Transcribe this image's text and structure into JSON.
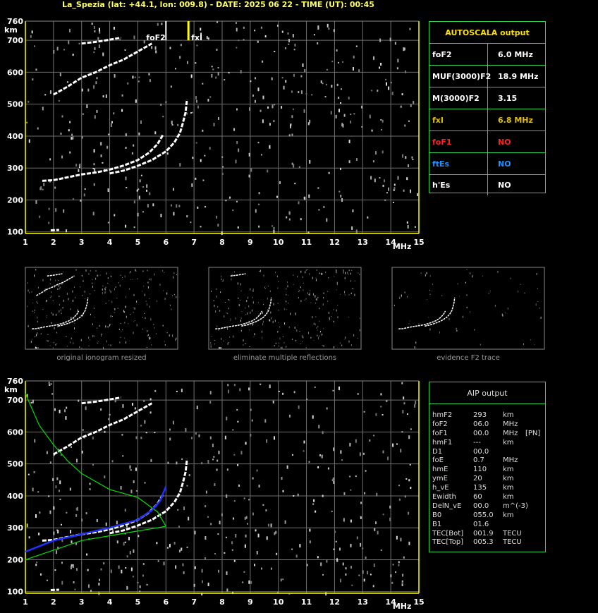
{
  "header": {
    "title": "La_Spezia (lat: +44.1, lon: 009.8) - DATE: 2025 06 22 - TIME (UT): 00:45"
  },
  "colors": {
    "frame": "#ffff00",
    "grid": "#707070",
    "table_border": "#2fcf4f",
    "profile_green": "#00e000",
    "profile_blue": "#2030ff",
    "foF1_label": "#ff2020",
    "ftEs_label": "#2090ff",
    "fxI_value": "#e0c000"
  },
  "chart_data": [
    {
      "type": "scatter",
      "name": "main-ionogram",
      "xlabel": "MHz",
      "ylabel": "km",
      "xlim": [
        1,
        15
      ],
      "ylim": [
        95,
        760
      ],
      "x_ticks": [
        "1",
        "2",
        "3",
        "4",
        "5",
        "6",
        "7",
        "8",
        "9",
        "10",
        "11",
        "12",
        "13",
        "14",
        "15"
      ],
      "y_ticks": [
        "100",
        "200",
        "300",
        "400",
        "500",
        "600",
        "700",
        "760"
      ],
      "markers": [
        {
          "label": "foF2",
          "x": 6.0
        },
        {
          "label": "fxI",
          "x": 6.8
        }
      ],
      "traces": [
        {
          "name": "o-trace",
          "x": [
            1.6,
            2.0,
            3.0,
            3.5,
            4.0,
            4.5,
            5.0,
            5.4,
            5.7,
            5.9
          ],
          "y": [
            260,
            262,
            280,
            286,
            295,
            308,
            325,
            348,
            375,
            405
          ]
        },
        {
          "name": "x-trace",
          "x": [
            4.0,
            4.5,
            5.0,
            5.5,
            6.0,
            6.3,
            6.5,
            6.6,
            6.7,
            6.75
          ],
          "y": [
            283,
            292,
            307,
            325,
            352,
            380,
            410,
            440,
            475,
            515
          ]
        },
        {
          "name": "multiple-reflection",
          "x": [
            2.0,
            2.5,
            3.0,
            3.5,
            4.0,
            4.5,
            5.0,
            5.5
          ],
          "y": [
            530,
            555,
            583,
            600,
            622,
            640,
            665,
            690
          ]
        },
        {
          "name": "upper-echo",
          "x": [
            3.0,
            3.5,
            4.0,
            4.4
          ],
          "y": [
            690,
            695,
            702,
            708
          ]
        },
        {
          "name": "low-echo",
          "x": [
            1.9,
            2.2
          ],
          "y": [
            105,
            106
          ]
        }
      ]
    },
    {
      "type": "scatter",
      "name": "aip-ionogram",
      "xlabel": "MHz",
      "ylabel": "km",
      "xlim": [
        1,
        15
      ],
      "ylim": [
        95,
        760
      ],
      "x_ticks": [
        "1",
        "2",
        "3",
        "4",
        "5",
        "6",
        "7",
        "8",
        "9",
        "10",
        "11",
        "12",
        "13",
        "14",
        "15"
      ],
      "y_ticks": [
        "100",
        "200",
        "300",
        "400",
        "500",
        "600",
        "700",
        "760"
      ],
      "profile_green_upper": {
        "x": [
          1.0,
          1.5,
          2.0,
          2.5,
          3.0,
          4.0,
          5.0,
          5.7,
          6.0
        ],
        "y": [
          720,
          620,
          560,
          510,
          470,
          420,
          395,
          350,
          305
        ]
      },
      "profile_green_lower": {
        "x": [
          1.0,
          2.0,
          3.0,
          4.0,
          5.0,
          5.7,
          6.0
        ],
        "y": [
          200,
          230,
          260,
          275,
          290,
          300,
          305
        ]
      },
      "profile_blue": {
        "x": [
          1.0,
          2.0,
          3.0,
          4.0,
          5.0,
          5.5,
          5.8,
          6.0
        ],
        "y": [
          225,
          260,
          280,
          300,
          325,
          355,
          385,
          430
        ]
      }
    }
  ],
  "axis": {
    "unit_x": "MHz",
    "unit_y": "km"
  },
  "autoscala": {
    "title": "AUTOSCALA output",
    "rows": [
      {
        "key": "foF2",
        "value": "6.0 MHz",
        "key_color": "#ffffff",
        "value_color": "#ffffff"
      },
      {
        "key": "MUF(3000)F2",
        "value": "18.9 MHz",
        "key_color": "#ffffff",
        "value_color": "#ffffff"
      },
      {
        "key": "M(3000)F2",
        "value": "3.15",
        "key_color": "#ffffff",
        "value_color": "#ffffff"
      },
      {
        "key": "fxI",
        "value": "6.8 MHz",
        "key_color": "#e0c000",
        "value_color": "#e0c000"
      },
      {
        "key": "foF1",
        "value": "NO",
        "key_color": "#ff2020",
        "value_color": "#ff2020"
      },
      {
        "key": "ftEs",
        "value": "NO",
        "key_color": "#2090ff",
        "value_color": "#2090ff"
      },
      {
        "key": "h'Es",
        "value": "NO",
        "key_color": "#ffffff",
        "value_color": "#ffffff"
      }
    ]
  },
  "mini_panels": [
    {
      "caption": "original ionogram resized"
    },
    {
      "caption": "eliminate multiple reflections"
    },
    {
      "caption": "evidence F2 trace"
    }
  ],
  "aip": {
    "title": "AIP output",
    "rows": [
      [
        "hmF2",
        "293",
        "km",
        ""
      ],
      [
        "foF2",
        "06.0",
        "MHz",
        ""
      ],
      [
        "foF1",
        "00.0",
        "MHz",
        "[PN]"
      ],
      [
        "hmF1",
        "---",
        "km",
        ""
      ],
      [
        "D1",
        "00.0",
        "",
        ""
      ],
      [
        "foE",
        "0.7",
        "MHz",
        ""
      ],
      [
        "hmE",
        "110",
        "km",
        ""
      ],
      [
        "ymE",
        "20",
        "km",
        ""
      ],
      [
        "h_vE",
        "135",
        "km",
        ""
      ],
      [
        "Ewidth",
        "60",
        "km",
        ""
      ],
      [
        "DelN_vE",
        "00.0",
        "m^(-3)",
        ""
      ],
      [
        "B0",
        "055.0",
        "km",
        ""
      ],
      [
        "B1",
        "01.6",
        "",
        ""
      ],
      [
        "TEC[Bot]",
        "001.9",
        "TECU",
        ""
      ],
      [
        "TEC[Top]",
        "005.3",
        "TECU",
        ""
      ]
    ]
  }
}
